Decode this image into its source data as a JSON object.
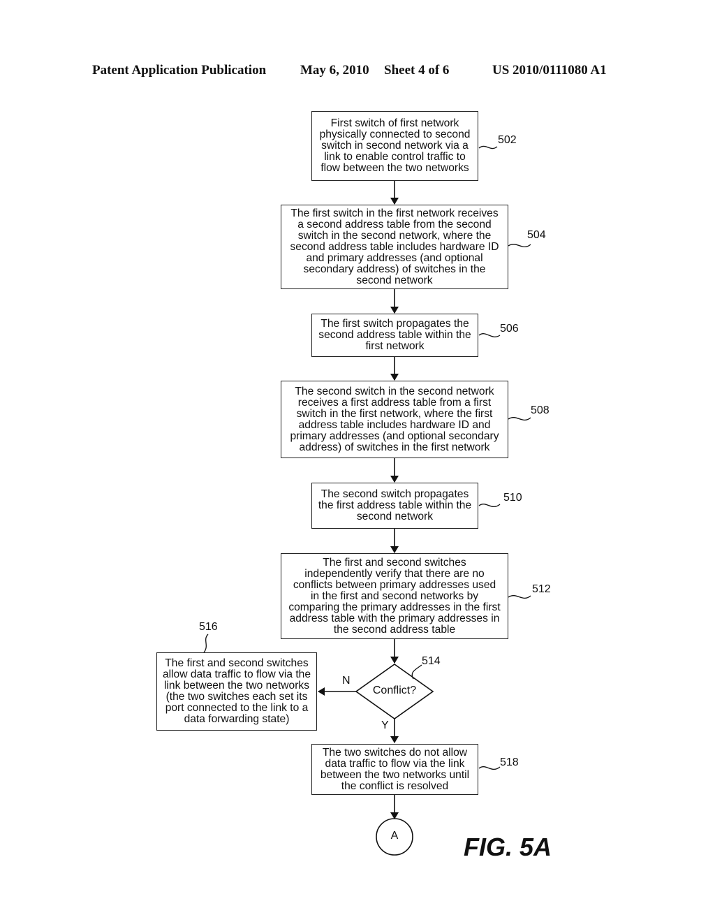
{
  "header": {
    "left": "Patent Application Publication",
    "date": "May 6, 2010",
    "sheet": "Sheet 4 of 6",
    "number": "US 2010/0111080 A1"
  },
  "steps": [
    {
      "ref": "502",
      "text": "First switch of first network\nphysically connected to second\nswitch in second network via a\nlink to enable control traffic to\nflow between the two networks"
    },
    {
      "ref": "504",
      "text": "The first switch in the first network receives\na second address table from the second\nswitch in the second network, where the\nsecond address table includes  hardware ID\nand primary addresses (and optional\nsecondary address) of switches in the\nsecond network"
    },
    {
      "ref": "506",
      "text": "The first switch propagates the\nsecond address table within the\nfirst network"
    },
    {
      "ref": "508",
      "text": "The second switch in the second network\nreceives a first address table from a first\nswitch in the first network, where the first\naddress table includes hardware ID and\nprimary addresses (and optional secondary\naddress) of switches in the first network"
    },
    {
      "ref": "510",
      "text": "The second switch propagates\nthe first address table within the\nsecond network"
    },
    {
      "ref": "512",
      "text": "The first and second switches\nindependently verify that there are no\nconflicts between primary addresses used\nin the first and second networks by\ncomparing the primary addresses in the first\naddress table with the primary addresses in\nthe second address table"
    },
    {
      "ref": "516",
      "text": "The first and second switches\nallow data traffic to flow via the\nlink between the two networks\n(the two switches each set its\nport connected to the link to a\ndata forwarding state)"
    },
    {
      "ref": "518",
      "text": "The two switches do not allow\ndata traffic to flow via the link\nbetween the two networks until\nthe conflict is resolved"
    }
  ],
  "decision": {
    "ref": "514",
    "text": "Conflict?",
    "no_label": "N",
    "yes_label": "Y"
  },
  "connector": {
    "label": "A"
  },
  "figure_label": "FIG. 5A"
}
